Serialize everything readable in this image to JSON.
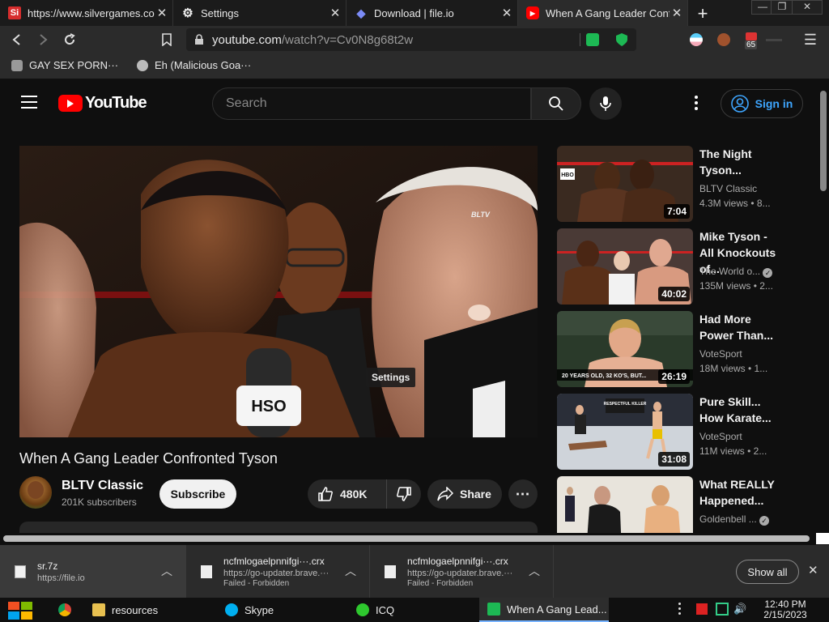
{
  "browser": {
    "tabs": [
      {
        "title": "https://www.silvergames.co",
        "favicon_text": "Si",
        "favicon_color": "#d72d2d"
      },
      {
        "title": "Settings",
        "favicon_text": "⚙",
        "favicon_color": "#1b1b1b"
      },
      {
        "title": "Download | file.io",
        "favicon_text": "◆",
        "favicon_color": "#5b6bd6"
      },
      {
        "title": "When A Gang Leader Confr",
        "favicon_text": "▶",
        "favicon_color": "#ff0000"
      }
    ],
    "window_controls": [
      "—",
      "❐",
      "✕"
    ],
    "url": {
      "host": "youtube.com",
      "path": "/watch?v=Cv0N8g68t2w"
    },
    "extension_badge": "65",
    "bookmarks": [
      "GAY SEX PORN···",
      "Eh (Malicious Goa···"
    ]
  },
  "youtube": {
    "logo_text": "YouTube",
    "search_placeholder": "Search",
    "signin_label": "Sign in",
    "player": {
      "watermark": "BLTV",
      "tooltip": "Settings",
      "mic_text": "HSO"
    },
    "video": {
      "title": "When A Gang Leader Confronted Tyson",
      "channel": "BLTV Classic",
      "subscribers": "201K subscribers",
      "subscribe_label": "Subscribe",
      "likes": "480K",
      "share_label": "Share"
    },
    "recommended": [
      {
        "title": "The Night Tyson...",
        "channel": "BLTV Classic",
        "meta": "4.3M views • 8...",
        "duration": "7:04",
        "verified": false
      },
      {
        "title": "Mike Tyson - All Knockouts of...",
        "channel": "The World o...",
        "meta": "135M views • 2...",
        "duration": "40:02",
        "verified": true
      },
      {
        "title": "Had More Power Than...",
        "channel": "VoteSport",
        "meta": "18M views • 1...",
        "duration": "26:19",
        "verified": false
      },
      {
        "title": "Pure Skill... How Karate...",
        "channel": "VoteSport",
        "meta": "11M views • 2...",
        "duration": "31:08",
        "verified": false
      },
      {
        "title": "What REALLY Happened...",
        "channel": "Goldenbell ...",
        "meta": "",
        "duration": "",
        "verified": true
      }
    ],
    "thumb_captions": {
      "hbo": "HBO",
      "karate_badge": "RESPECTFUL KILLER",
      "ticker": "20 YEARS OLD, 32 KO'S, BUT..."
    }
  },
  "downloads": {
    "items": [
      {
        "name": "sr.7z",
        "source": "https://file.io",
        "status": ""
      },
      {
        "name": "ncfmlogaelpnnifgi···.crx",
        "source": "https://go-updater.brave.···",
        "status": "Failed - Forbidden"
      },
      {
        "name": "ncfmlogaelpnnifgi···.crx",
        "source": "https://go-updater.brave.···",
        "status": "Failed - Forbidden"
      }
    ],
    "show_all_label": "Show all"
  },
  "taskbar": {
    "items": [
      {
        "label": "",
        "icon": "chrome-icon"
      },
      {
        "label": "resources",
        "icon": "folder-icon"
      },
      {
        "label": "Skype",
        "icon": "skype-icon"
      },
      {
        "label": "ICQ",
        "icon": "icq-icon"
      },
      {
        "label": "When A Gang Lead...",
        "icon": "browser-icon"
      }
    ],
    "time": "12:40 PM",
    "date": "2/15/2023"
  }
}
